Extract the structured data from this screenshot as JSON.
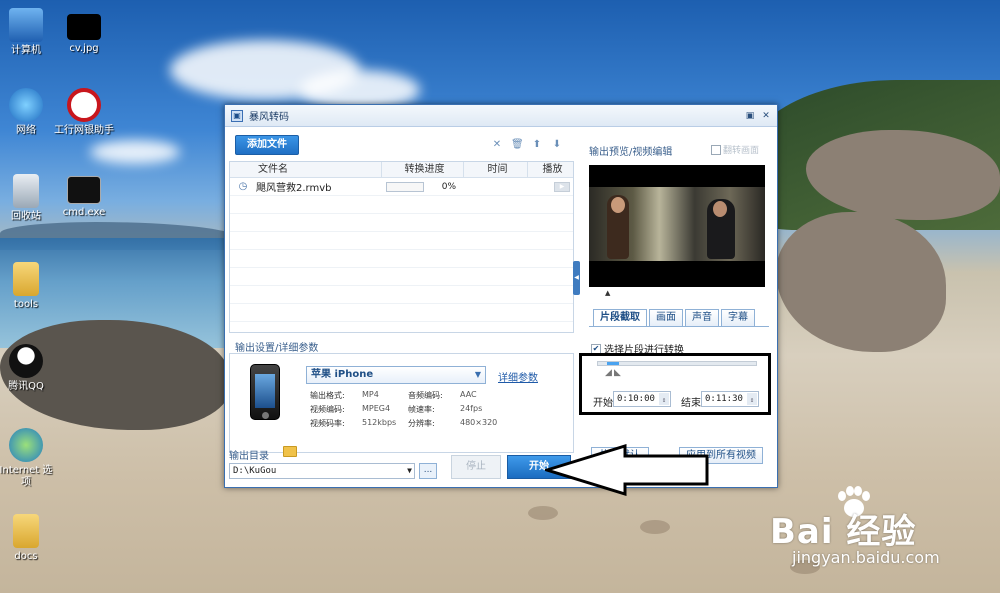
{
  "desktop": {
    "icons": [
      {
        "label": "计算机"
      },
      {
        "label": "cv.jpg"
      },
      {
        "label": "网络"
      },
      {
        "label": "工行网银助手"
      },
      {
        "label": "回收站"
      },
      {
        "label": "cmd.exe"
      },
      {
        "label": "tools"
      },
      {
        "label": "腾讯QQ"
      },
      {
        "label": "Internet 选项"
      },
      {
        "label": "docs"
      }
    ]
  },
  "window": {
    "title": "暴风转码",
    "controls": {
      "menu": "▣",
      "close": "✕"
    }
  },
  "toolbar": {
    "add_file": "添加文件",
    "icons": [
      "close-icon",
      "trash-icon",
      "arrow-up-icon",
      "arrow-down-icon"
    ]
  },
  "file_table": {
    "headers": {
      "name": "文件名",
      "progress": "转换进度",
      "time": "时间",
      "play": "播放"
    },
    "rows": [
      {
        "name": "飓风营救2.rmvb",
        "progress_text": "0%",
        "progress": 0,
        "time": ""
      }
    ]
  },
  "output_settings": {
    "section_label": "输出设置/详细参数",
    "device": "苹果 iPhone",
    "detail_link": "详细参数",
    "params": [
      {
        "label": "输出格式:",
        "value": "MP4"
      },
      {
        "label": "音频编码:",
        "value": "AAC"
      },
      {
        "label": "视频编码:",
        "value": "MPEG4"
      },
      {
        "label": "帧速率:",
        "value": "24fps"
      },
      {
        "label": "视频码率:",
        "value": "512kbps"
      },
      {
        "label": "分辨率:",
        "value": "480×320"
      }
    ]
  },
  "output_dir": {
    "label": "输出目录",
    "path": "D:\\KuGou",
    "browse": "..."
  },
  "actions": {
    "stop": "停止",
    "start": "开始"
  },
  "preview": {
    "label": "输出预览/视频编辑",
    "flip_label": "翻转画面",
    "flip_checked": false
  },
  "edit_tabs": [
    {
      "label": "片段截取",
      "active": true
    },
    {
      "label": "画面",
      "active": false
    },
    {
      "label": "声音",
      "active": false
    },
    {
      "label": "字幕",
      "active": false
    }
  ],
  "segment": {
    "checkbox_label": "选择片段进行转换",
    "checked": true,
    "start_label": "开始",
    "start_value": "0:10:00",
    "end_label": "结束",
    "end_value": "0:11:30",
    "reset_btn": "恢复默认",
    "apply_all_btn": "应用到所有视频"
  },
  "watermark": {
    "brand": "Bai  经验",
    "url": "jingyan.baidu.com"
  }
}
